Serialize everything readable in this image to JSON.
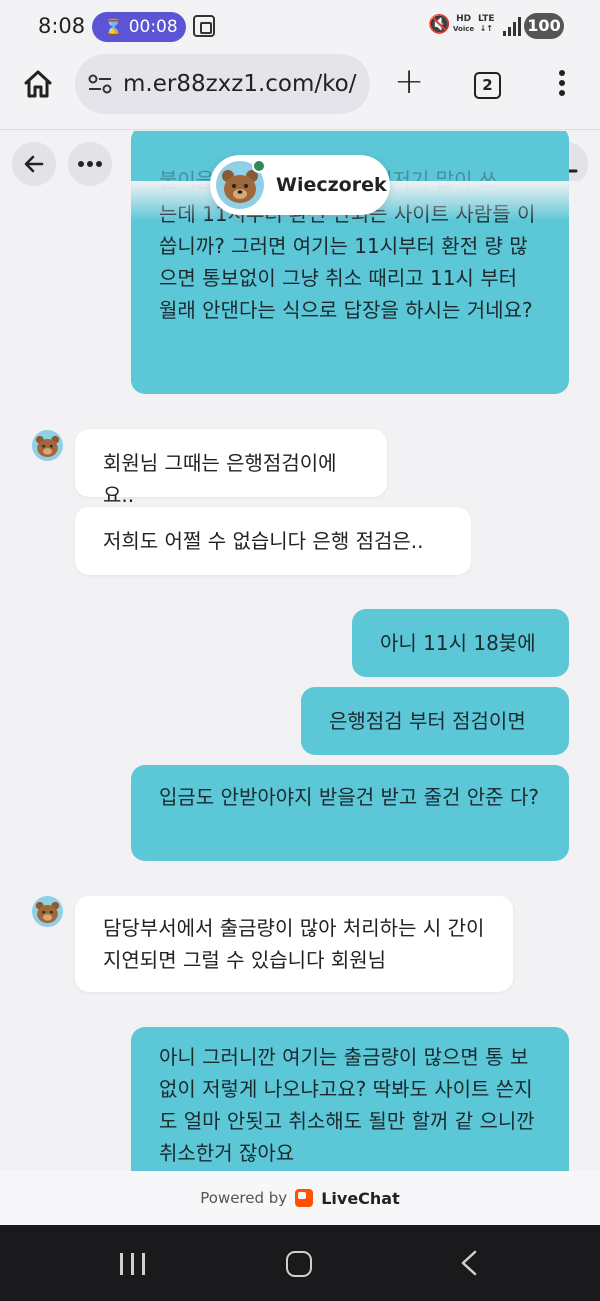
{
  "status_bar": {
    "time": "8:08",
    "timer": "00:08",
    "hd_label": "HD",
    "voice_label": "Voice",
    "lte_label": "LTE",
    "battery": "100"
  },
  "browser": {
    "url": "m.er88zxz1.com/ko/",
    "tab_count": "2"
  },
  "chat": {
    "agent_name": "Wieczorek",
    "messages": [
      {
        "from": "user",
        "text": "는데 11시부터 환전 안되는 사이트 사람들 이 씁니까? 그러면 여기는 11시부터 환전 량 많으면 통보없이 그냥 취소 때리고 11시 부터 월래 안댄다는 식으로 답장을 하시는 거네요?",
        "partial_top": "불이읍니까 여기걸보고 여기저기 많이 쓰"
      },
      {
        "from": "agent",
        "text": "회원님 그때는 은행점검이에요.."
      },
      {
        "from": "agent",
        "text": "저희도 어쩔 수 없습니다 은행 점검은.."
      },
      {
        "from": "user",
        "text": "아니 11시 18붗에"
      },
      {
        "from": "user",
        "text": "은행점검 부터 점검이면"
      },
      {
        "from": "user",
        "text": "입금도 안받아야지 받을건 받고 줄건 안준 다?"
      },
      {
        "from": "agent",
        "text": "담당부서에서 출금량이 많아 처리하는 시 간이 지연되면 그럴 수 있습니다 회원님"
      },
      {
        "from": "user",
        "text": "아니 그러니깐 여기는 출금량이 많으면 통 보 없이 저렇게 나오냐고요? 딱봐도 사이트 쓴지도 얼마 안됫고 취소해도 될만 할꺼 같 으니깐 취소한거 잖아요"
      }
    ]
  },
  "footer": {
    "powered_by": "Powered by",
    "brand": "LiveChat"
  },
  "colors": {
    "user_bubble": "#5cc7d7",
    "agent_bubble": "#ffffff",
    "timer_pill": "#5b55d6",
    "livechat_brand": "#ff5100",
    "online_dot": "#2e8b57"
  },
  "icons": [
    "home-icon",
    "site-settings-icon",
    "plus-icon",
    "tabs-icon",
    "menu-dots-icon",
    "back-arrow-icon",
    "more-dots-icon",
    "minimize-icon",
    "bear-avatar-icon",
    "livechat-logo-icon"
  ]
}
